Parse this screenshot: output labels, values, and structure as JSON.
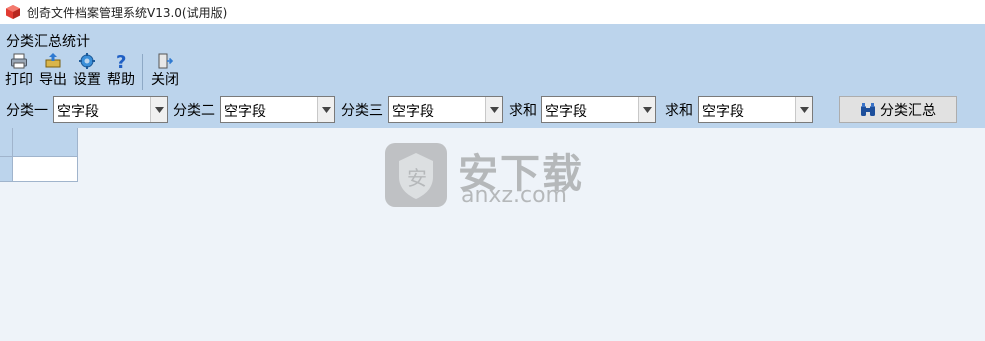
{
  "window": {
    "title": "创奇文件档案管理系统V13.0(试用版)"
  },
  "panel": {
    "title": "分类汇总统计"
  },
  "toolbar": {
    "print_label": "打印",
    "export_label": "导出",
    "settings_label": "设置",
    "help_label": "帮助",
    "close_label": "关闭"
  },
  "filters": {
    "cat1_label": "分类一",
    "cat1_value": "空字段",
    "cat2_label": "分类二",
    "cat2_value": "空字段",
    "cat3_label": "分类三",
    "cat3_value": "空字段",
    "sum1_label": "求和",
    "sum1_value": "空字段",
    "sum2_label": "求和",
    "sum2_value": "空字段",
    "summary_button": "分类汇总"
  },
  "watermark": {
    "main": "安下载",
    "sub": "anxz.com"
  },
  "colors": {
    "panel": "#bcd4ec",
    "grid_bg": "#eef3f9",
    "header_cell": "#bcd4ec"
  }
}
